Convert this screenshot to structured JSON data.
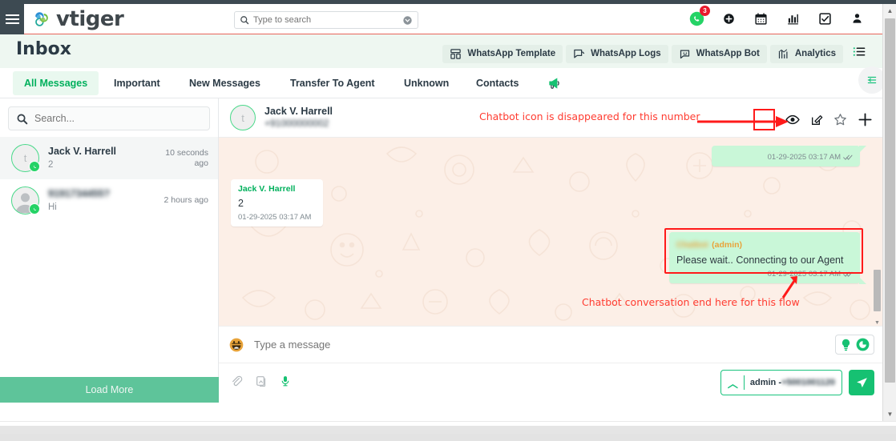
{
  "app": {
    "brand": "vtiger",
    "menu_icon": "hamburger-icon"
  },
  "topnav": {
    "search_placeholder": "Type to search",
    "search_value": "",
    "search_icon": "search-icon",
    "dropdown_icon": "chevron-circle-down-icon",
    "icons": [
      {
        "name": "whatsapp-icon",
        "badge": "3"
      },
      {
        "name": "add-circle-icon",
        "badge": ""
      },
      {
        "name": "calendar-icon",
        "badge": ""
      },
      {
        "name": "analytics-bar-icon",
        "badge": ""
      },
      {
        "name": "task-checkbox-icon",
        "badge": ""
      },
      {
        "name": "user-profile-icon",
        "badge": ""
      }
    ]
  },
  "module": {
    "title": "Inbox",
    "actions": [
      {
        "label": "WhatsApp Template",
        "icon": "template-layout-icon"
      },
      {
        "label": "WhatsApp Logs",
        "icon": "chat-log-icon"
      },
      {
        "label": "WhatsApp Bot",
        "icon": "bot-chat-icon"
      },
      {
        "label": "Analytics",
        "icon": "analytics-chart-icon"
      }
    ],
    "list_icon": "list-view-icon",
    "collapse_icon": "collapse-panel-icon"
  },
  "tabs": [
    {
      "label": "All Messages",
      "active": true
    },
    {
      "label": "Important",
      "active": false
    },
    {
      "label": "New Messages",
      "active": false
    },
    {
      "label": "Transfer To Agent",
      "active": false
    },
    {
      "label": "Unknown",
      "active": false
    },
    {
      "label": "Contacts",
      "active": false
    }
  ],
  "tabbar": {
    "megaphone_icon": "megaphone-icon"
  },
  "sidebar": {
    "search_placeholder": "Search...",
    "search_value": "",
    "search_icon": "search-icon",
    "load_more_label": "Load More",
    "contacts": [
      {
        "name": "Jack V. Harrell",
        "snippet": "2",
        "time": "10 seconds ago",
        "avatar_initial": "t",
        "selected": true,
        "blurred": false
      },
      {
        "name": "9191734455?",
        "snippet": "Hi",
        "time": "2 hours ago",
        "avatar_initial": "",
        "selected": false,
        "blurred": true
      }
    ]
  },
  "chat_header": {
    "name": "Jack V. Harrell",
    "number": "+91000000002",
    "avatar_initial": "t",
    "actions": [
      {
        "name": "missing-chatbot-icon",
        "highlight": true
      },
      {
        "name": "eye-icon",
        "highlight": false
      },
      {
        "name": "edit-icon",
        "highlight": false
      },
      {
        "name": "star-icon",
        "highlight": false
      },
      {
        "name": "plus-icon",
        "highlight": false
      }
    ]
  },
  "annotations": [
    {
      "text": "Chatbot icon is disappeared for this number",
      "id": "annotation-chatbot-missing"
    },
    {
      "text": "Chatbot conversation end here for this flow",
      "id": "annotation-conversation-end"
    }
  ],
  "messages": [
    {
      "direction": "out",
      "sender": "",
      "text": "",
      "time": "01-29-2025 03:17 AM",
      "status_icon": "double-check-icon",
      "highlighted": false
    },
    {
      "direction": "in",
      "sender": "Jack V. Harrell",
      "text": "2",
      "time": "01-29-2025 03:17 AM",
      "status_icon": "",
      "highlighted": false
    },
    {
      "direction": "out",
      "sender": "Chatbot (admin)",
      "sender_suffix": "(admin)",
      "text": "Please wait.. Connecting to our Agent",
      "time": "01-29-2025 03:17 AM",
      "status_icon": "double-check-icon",
      "highlighted": true
    }
  ],
  "composer": {
    "placeholder": "Type a message",
    "value": "",
    "emoji_icon": "emoji-smiley-icon",
    "quick_icons": [
      {
        "name": "bulb-icon"
      },
      {
        "name": "refresh-circle-icon"
      }
    ],
    "attach_icons": [
      {
        "name": "paperclip-icon"
      },
      {
        "name": "image-attach-icon"
      },
      {
        "name": "microphone-icon"
      }
    ],
    "from_label": "admin - ",
    "from_number": "+5001001120",
    "from_chevron_icon": "chevron-up-icon",
    "send_icon": "send-plane-icon"
  }
}
